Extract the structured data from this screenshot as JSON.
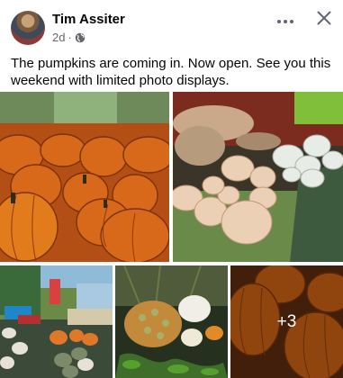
{
  "post": {
    "author": "Tim Assiter",
    "age": "2d",
    "visibility_icon": "globe-icon",
    "text": "The pumpkins are coming in. Now open. See you this weekend with limited photo displays."
  },
  "header": {
    "more_icon": "more-icon",
    "close_icon": "close-icon"
  },
  "gallery": {
    "more_count": "+3"
  },
  "colors": {
    "pumpkin_orange": "#e0781e",
    "white_pumpkin": "#f1e4d4",
    "text_secondary": "#65676b"
  }
}
